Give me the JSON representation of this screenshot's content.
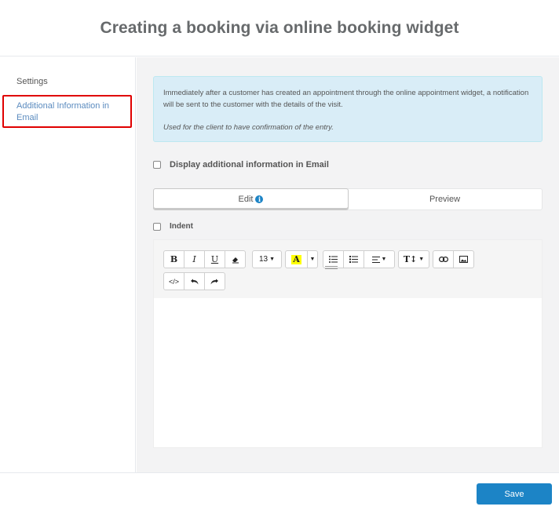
{
  "page": {
    "title": "Creating a booking via online booking widget"
  },
  "sidebar": {
    "items": [
      {
        "label": "Settings"
      },
      {
        "label": "Additional Information in Email"
      }
    ]
  },
  "info_box": {
    "text": "Immediately after a customer has created an appointment through the online appointment widget, a notification will be sent to the customer with the details of the visit.",
    "note": "Used for the client to have confirmation of the entry."
  },
  "display_checkbox": {
    "label": "Display additional information in Email",
    "checked": false
  },
  "tabs": [
    {
      "label": "Edit",
      "icon": "info-icon"
    },
    {
      "label": "Preview"
    }
  ],
  "indent_checkbox": {
    "label": "Indent",
    "checked": false
  },
  "toolbar": {
    "bold": "B",
    "italic": "I",
    "underline": "U",
    "eraser": "eraser-icon",
    "font_size": "13",
    "highlight": "A",
    "highlight_color": "#ffff00",
    "unordered_list": "unordered-list-icon",
    "ordered_list": "ordered-list-icon",
    "align": "align-left-icon",
    "text_height": "T↕",
    "link": "link-icon",
    "image": "image-icon",
    "code": "</>",
    "undo": "undo-icon",
    "redo": "redo-icon"
  },
  "footer": {
    "save_label": "Save"
  },
  "colors": {
    "accent": "#1c84c6",
    "info_bg": "#d9edf7",
    "highlight_border": "#e00000"
  }
}
